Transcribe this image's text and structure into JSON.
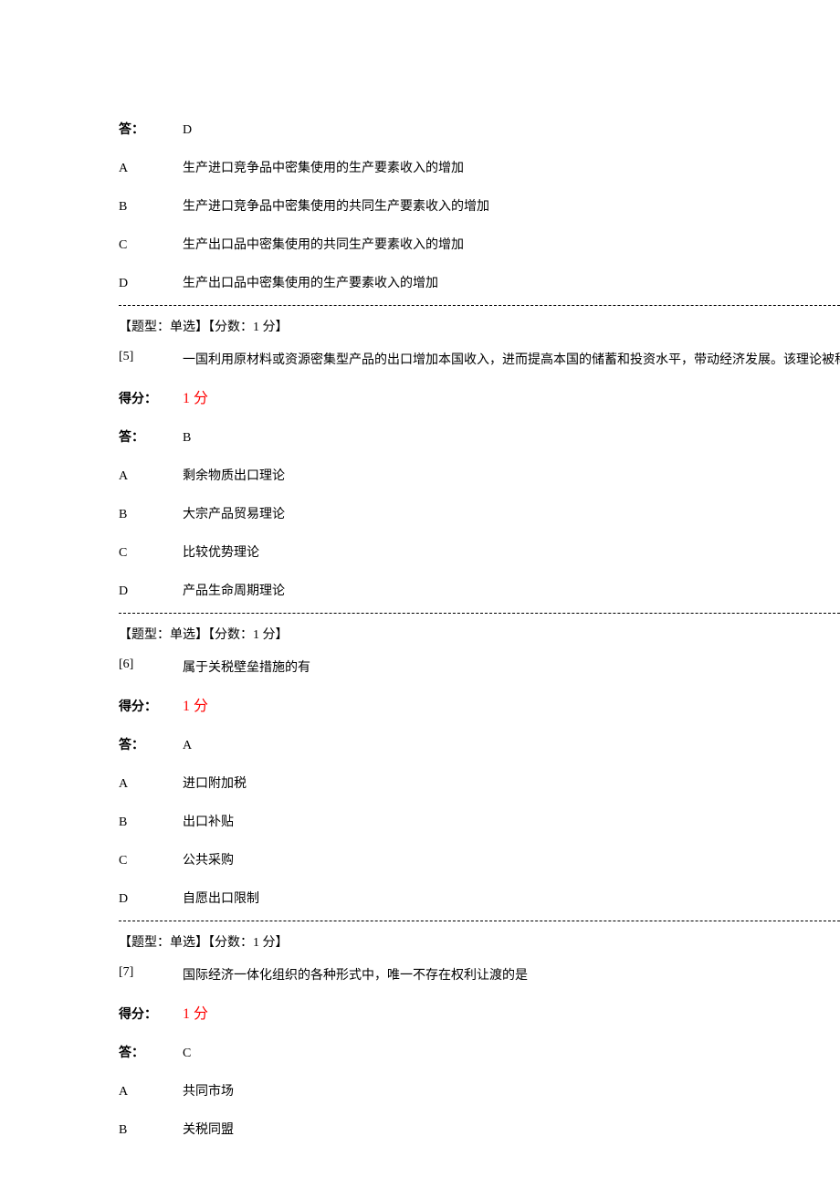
{
  "labels": {
    "answer": "答：",
    "score": "得分：",
    "score_value": "1 分",
    "meta": "【题型：单选】【分数：1 分】"
  },
  "q4": {
    "answer": "D",
    "optA": "生产进口竞争品中密集使用的生产要素收入的增加",
    "optB": "生产进口竞争品中密集使用的共同生产要素收入的增加",
    "optC": "生产出口品中密集使用的共同生产要素收入的增加",
    "optD": "生产出口品中密集使用的生产要素收入的增加"
  },
  "q5": {
    "num": "[5]",
    "text": "一国利用原材料或资源密集型产品的出口增加本国收入，进而提高本国的储蓄和投资水平，带动经济发展。该理论被称",
    "answer": "B",
    "optA": "剩余物质出口理论",
    "optB": "大宗产品贸易理论",
    "optC": "比较优势理论",
    "optD": "产品生命周期理论"
  },
  "q6": {
    "num": "[6]",
    "text": "属于关税壁垒措施的有",
    "answer": "A",
    "optA": "进口附加税",
    "optB": "出口补贴",
    "optC": "公共采购",
    "optD": "自愿出口限制"
  },
  "q7": {
    "num": "[7]",
    "text": "国际经济一体化组织的各种形式中，唯一不存在权利让渡的是",
    "answer": "C",
    "optA": "共同市场",
    "optB": "关税同盟"
  }
}
